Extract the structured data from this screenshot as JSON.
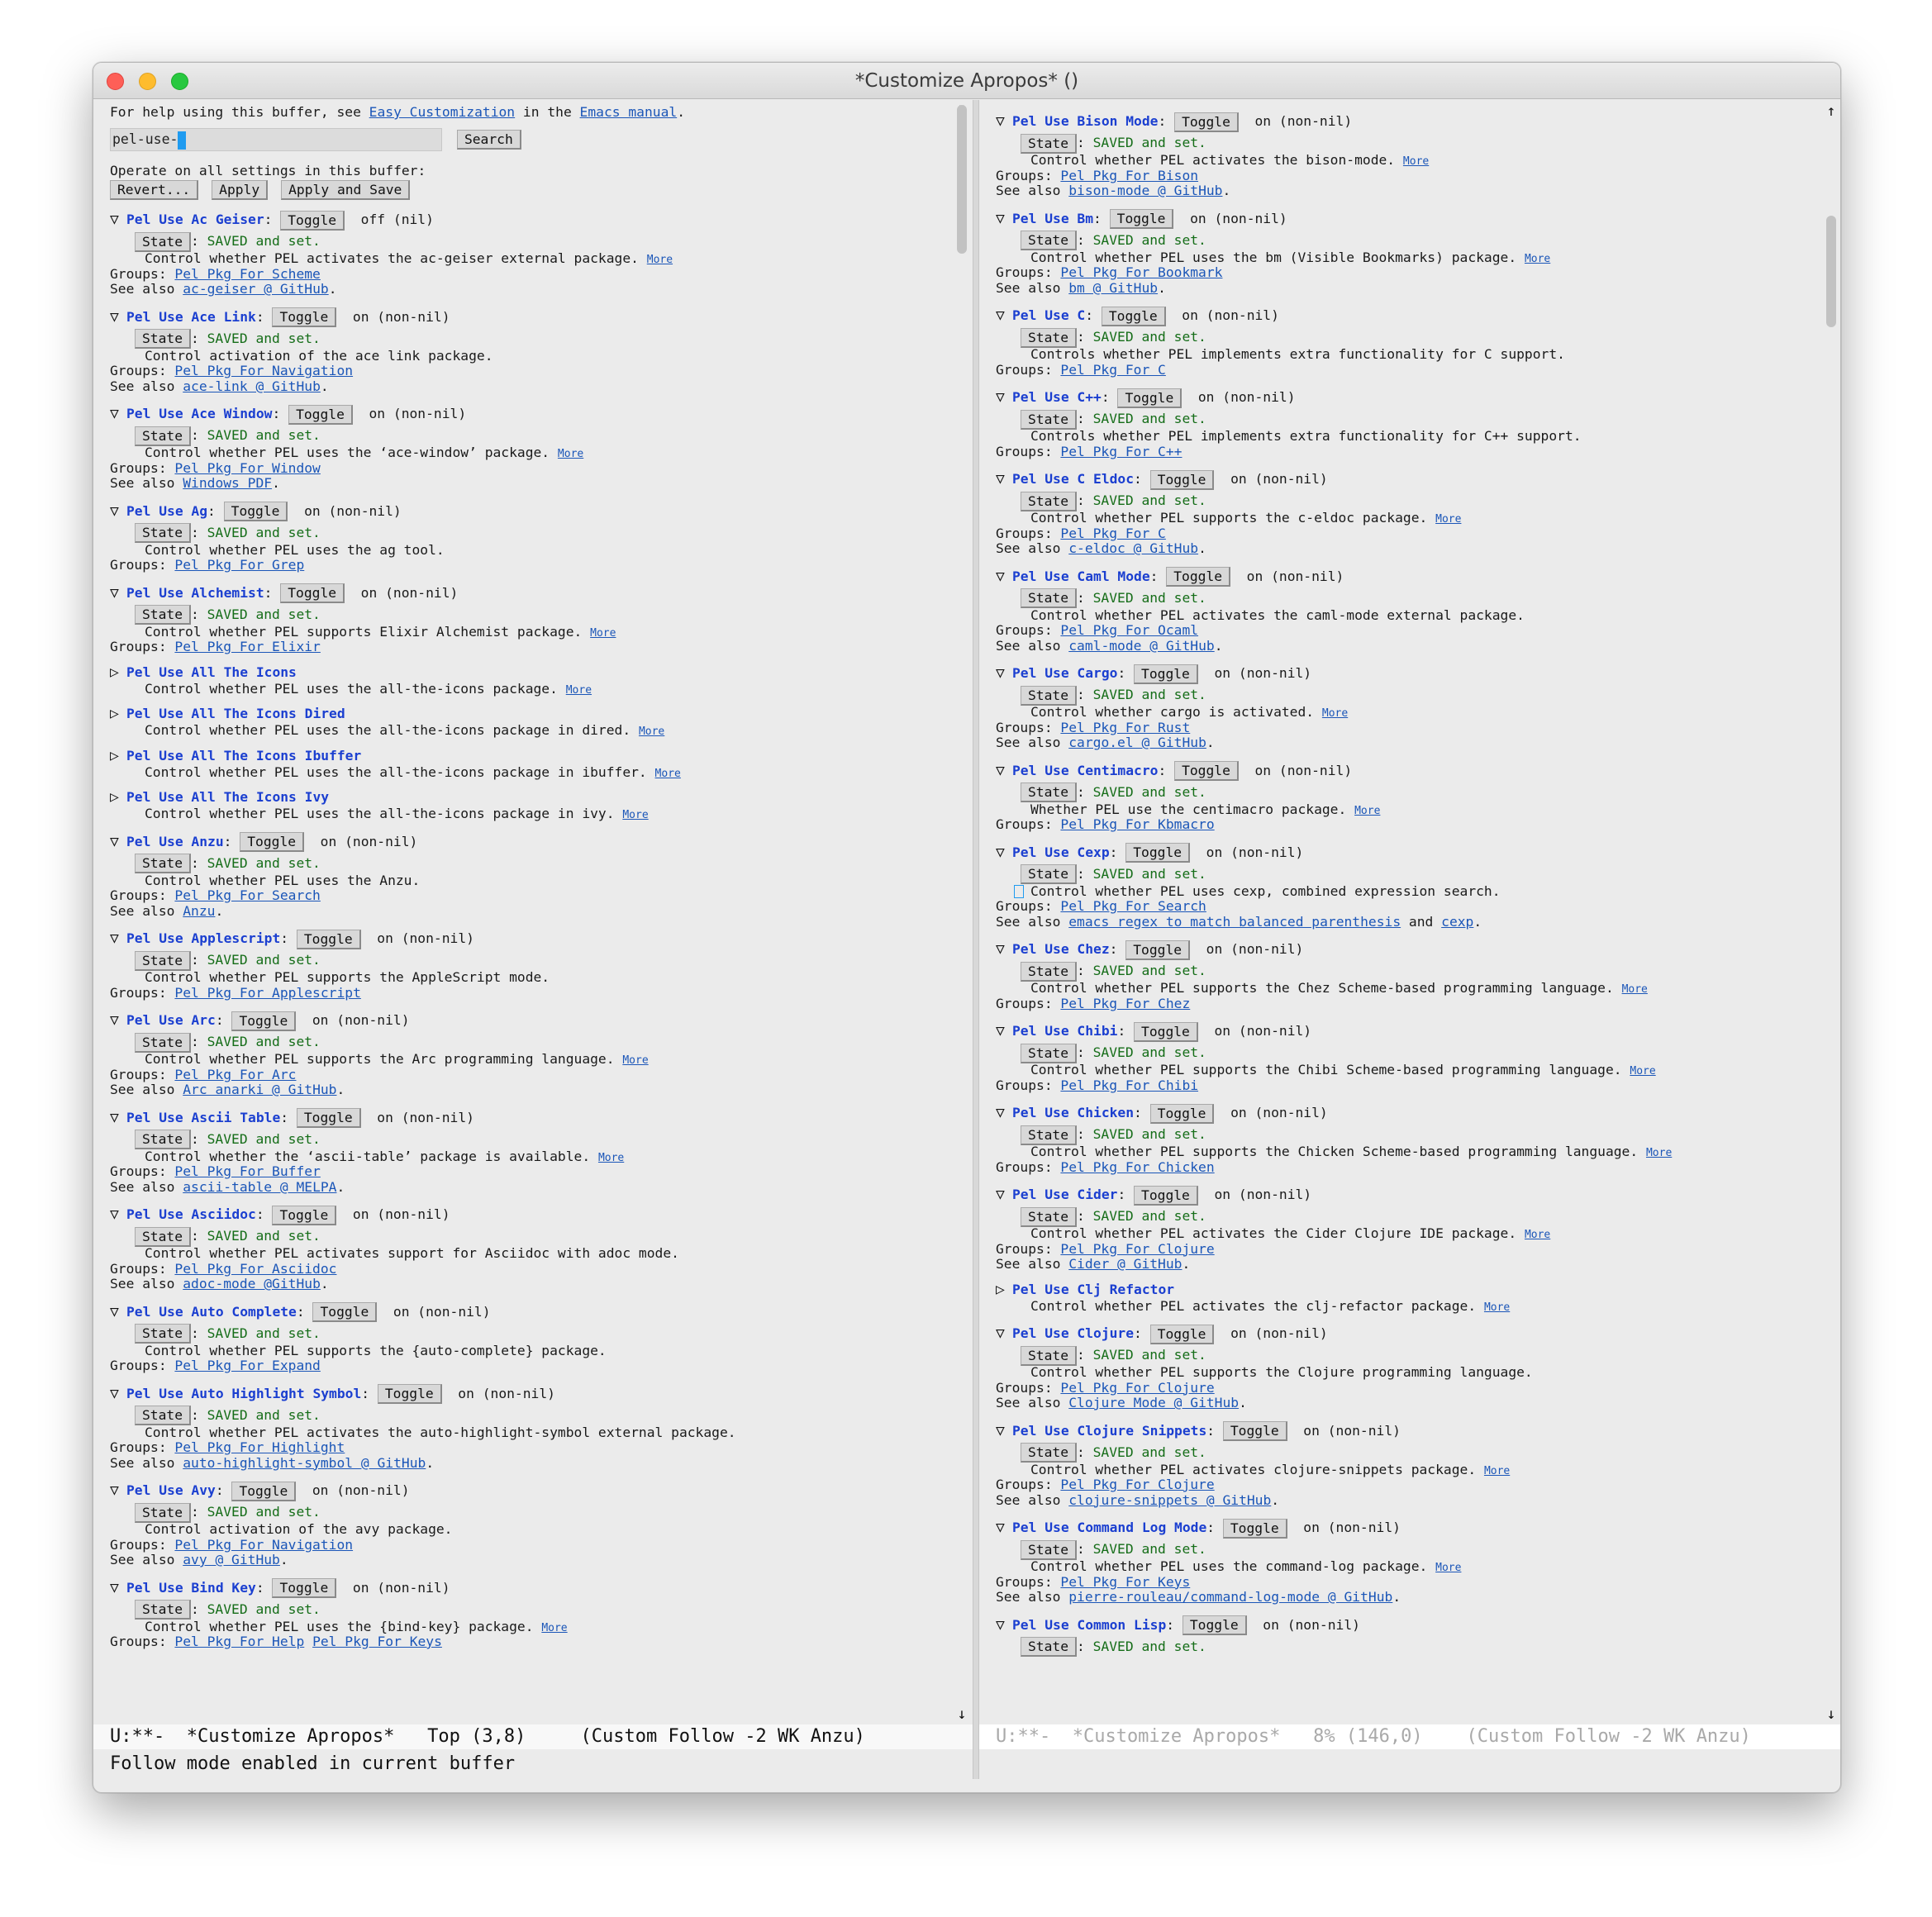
{
  "window": {
    "title": "*Customize Apropos* ()"
  },
  "left": {
    "help": {
      "prefix": "For help using this buffer, see ",
      "link1": "Easy Customization",
      "middle": " in the ",
      "link2": "Emacs manual",
      "suffix": "."
    },
    "search": {
      "value": "pel-use-",
      "button": "Search"
    },
    "operate": {
      "label": "Operate on all settings in this buffer:",
      "revert": "Revert...",
      "apply": "Apply",
      "apply_save": "Apply and Save"
    },
    "items": [
      {
        "expanded": true,
        "name": "Pel Use Ac Geiser",
        "value": "off (nil)",
        "desc": "Control whether PEL activates the ac-geiser external package.",
        "more": true,
        "groups": [
          "Pel Pkg For Scheme"
        ],
        "see": [
          "ac-geiser @ GitHub"
        ]
      },
      {
        "expanded": true,
        "name": "Pel Use Ace Link",
        "value": "on (non-nil)",
        "desc": "Control activation of the ace link package.",
        "more": false,
        "groups": [
          "Pel Pkg For Navigation"
        ],
        "see": [
          "ace-link @ GitHub"
        ]
      },
      {
        "expanded": true,
        "name": "Pel Use Ace Window",
        "value": "on (non-nil)",
        "desc": "Control whether PEL uses the ‘ace-window’ package.",
        "more": true,
        "groups": [
          "Pel Pkg For Window"
        ],
        "see": [
          "Windows PDF"
        ]
      },
      {
        "expanded": true,
        "name": "Pel Use Ag",
        "value": "on (non-nil)",
        "desc": "Control whether PEL uses the ag tool.",
        "more": false,
        "groups": [
          "Pel Pkg For Grep"
        ],
        "see": []
      },
      {
        "expanded": true,
        "name": "Pel Use Alchemist",
        "value": "on (non-nil)",
        "desc": "Control whether PEL supports Elixir Alchemist package.",
        "more": true,
        "groups": [
          "Pel Pkg For Elixir"
        ],
        "see": []
      },
      {
        "expanded": false,
        "name": "Pel Use All The Icons",
        "desc": "Control whether PEL uses the all-the-icons package.",
        "more": true
      },
      {
        "expanded": false,
        "name": "Pel Use All The Icons Dired",
        "desc": "Control whether PEL uses the all-the-icons package in dired.",
        "more": true
      },
      {
        "expanded": false,
        "name": "Pel Use All The Icons Ibuffer",
        "desc": "Control whether PEL uses the all-the-icons package in ibuffer.",
        "more": true
      },
      {
        "expanded": false,
        "name": "Pel Use All The Icons Ivy",
        "desc": "Control whether PEL uses the all-the-icons package in ivy.",
        "more": true
      },
      {
        "expanded": true,
        "name": "Pel Use Anzu",
        "value": "on (non-nil)",
        "desc": "Control whether PEL uses the Anzu.",
        "more": false,
        "groups": [
          "Pel Pkg For Search"
        ],
        "see": [
          "Anzu"
        ]
      },
      {
        "expanded": true,
        "name": "Pel Use Applescript",
        "value": "on (non-nil)",
        "desc": "Control whether PEL supports the AppleScript mode.",
        "more": false,
        "groups": [
          "Pel Pkg For Applescript"
        ],
        "see": []
      },
      {
        "expanded": true,
        "name": "Pel Use Arc",
        "value": "on (non-nil)",
        "desc": "Control whether PEL supports the Arc programming language.",
        "more": true,
        "groups": [
          "Pel Pkg For Arc"
        ],
        "see": [
          "Arc anarki @ GitHub"
        ]
      },
      {
        "expanded": true,
        "name": "Pel Use Ascii Table",
        "value": "on (non-nil)",
        "desc": "Control whether the ‘ascii-table’ package is available.",
        "more": true,
        "groups": [
          "Pel Pkg For Buffer"
        ],
        "see": [
          "ascii-table @ MELPA"
        ]
      },
      {
        "expanded": true,
        "name": "Pel Use Asciidoc",
        "value": "on (non-nil)",
        "desc": "Control whether PEL activates support for Asciidoc with adoc mode.",
        "more": false,
        "groups": [
          "Pel Pkg For Asciidoc"
        ],
        "see": [
          "adoc-mode @GitHub"
        ]
      },
      {
        "expanded": true,
        "name": "Pel Use Auto Complete",
        "value": "on (non-nil)",
        "desc": "Control whether PEL supports the {auto-complete} package.",
        "more": false,
        "groups": [
          "Pel Pkg For Expand"
        ],
        "see": []
      },
      {
        "expanded": true,
        "name": "Pel Use Auto Highlight Symbol",
        "value": "on (non-nil)",
        "desc": "Control whether PEL activates the auto-highlight-symbol external package.",
        "more": false,
        "groups": [
          "Pel Pkg For Highlight"
        ],
        "see": [
          "auto-highlight-symbol @ GitHub"
        ]
      },
      {
        "expanded": true,
        "name": "Pel Use Avy",
        "value": "on (non-nil)",
        "desc": "Control activation of the avy package.",
        "more": false,
        "groups": [
          "Pel Pkg For Navigation"
        ],
        "see": [
          "avy @ GitHub"
        ]
      },
      {
        "expanded": true,
        "name": "Pel Use Bind Key",
        "value": "on (non-nil)",
        "desc": "Control whether PEL uses the {bind-key} package.",
        "more": true,
        "groups": [
          "Pel Pkg For Help",
          "Pel Pkg For Keys"
        ],
        "see": []
      }
    ],
    "modeline": "U:**-  *Customize Apropos*   Top (3,8)     (Custom Follow -2 WK Anzu)"
  },
  "right": {
    "items": [
      {
        "expanded": true,
        "name": "Pel Use Bison Mode",
        "value": "on (non-nil)",
        "desc": "Control whether PEL activates the bison-mode.",
        "more": true,
        "groups": [
          "Pel Pkg For Bison"
        ],
        "see": [
          "bison-mode @ GitHub"
        ]
      },
      {
        "expanded": true,
        "name": "Pel Use Bm",
        "value": "on (non-nil)",
        "desc": "Control whether PEL uses the bm (Visible Bookmarks) package.",
        "more": true,
        "groups": [
          "Pel Pkg For Bookmark"
        ],
        "see": [
          "bm @ GitHub"
        ]
      },
      {
        "expanded": true,
        "name": "Pel Use C",
        "value": "on (non-nil)",
        "desc": "Controls whether PEL implements extra functionality for C support.",
        "more": false,
        "groups": [
          "Pel Pkg For C"
        ],
        "see": []
      },
      {
        "expanded": true,
        "name": "Pel Use C++",
        "value": "on (non-nil)",
        "desc": "Controls whether PEL implements extra functionality for C++ support.",
        "more": false,
        "groups": [
          "Pel Pkg For C++"
        ],
        "see": []
      },
      {
        "expanded": true,
        "name": "Pel Use C Eldoc",
        "value": "on (non-nil)",
        "desc": "Control whether PEL supports the c-eldoc package.",
        "more": true,
        "groups": [
          "Pel Pkg For C"
        ],
        "see": [
          "c-eldoc @ GitHub"
        ]
      },
      {
        "expanded": true,
        "name": "Pel Use Caml Mode",
        "value": "on (non-nil)",
        "desc": "Control whether PEL activates the caml-mode external package.",
        "more": false,
        "groups": [
          "Pel Pkg For Ocaml"
        ],
        "see": [
          "caml-mode @ GitHub"
        ]
      },
      {
        "expanded": true,
        "name": "Pel Use Cargo",
        "value": "on (non-nil)",
        "desc": "Control whether cargo is activated.",
        "more": true,
        "groups": [
          "Pel Pkg For Rust"
        ],
        "see": [
          "cargo.el @ GitHub"
        ]
      },
      {
        "expanded": true,
        "name": "Pel Use Centimacro",
        "value": "on (non-nil)",
        "desc": "Whether PEL use the centimacro package.",
        "more": true,
        "groups": [
          "Pel Pkg For Kbmacro"
        ],
        "see": []
      },
      {
        "expanded": true,
        "name": "Pel Use Cexp",
        "value": "on (non-nil)",
        "desc": "Control whether PEL uses cexp, combined expression search.",
        "more": false,
        "groups": [
          "Pel Pkg For Search"
        ],
        "see": [
          "emacs regex to match balanced parenthesis",
          "cexp"
        ],
        "marker": true
      },
      {
        "expanded": true,
        "name": "Pel Use Chez",
        "value": "on (non-nil)",
        "desc": "Control whether PEL supports the Chez Scheme-based programming language.",
        "more": true,
        "groups": [
          "Pel Pkg For Chez"
        ],
        "see": []
      },
      {
        "expanded": true,
        "name": "Pel Use Chibi",
        "value": "on (non-nil)",
        "desc": "Control whether PEL supports the Chibi Scheme-based programming language.",
        "more": true,
        "groups": [
          "Pel Pkg For Chibi"
        ],
        "see": []
      },
      {
        "expanded": true,
        "name": "Pel Use Chicken",
        "value": "on (non-nil)",
        "desc": "Control whether PEL supports the Chicken Scheme-based programming language.",
        "more": true,
        "groups": [
          "Pel Pkg For Chicken"
        ],
        "see": []
      },
      {
        "expanded": true,
        "name": "Pel Use Cider",
        "value": "on (non-nil)",
        "desc": "Control whether PEL activates the Cider Clojure IDE package.",
        "more": true,
        "groups": [
          "Pel Pkg For Clojure"
        ],
        "see": [
          "Cider @ GitHub"
        ]
      },
      {
        "expanded": false,
        "name": "Pel Use Clj Refactor",
        "desc": "Control whether PEL activates the clj-refactor package.",
        "more": true
      },
      {
        "expanded": true,
        "name": "Pel Use Clojure",
        "value": "on (non-nil)",
        "desc": "Control whether PEL supports the Clojure programming language.",
        "more": false,
        "groups": [
          "Pel Pkg For Clojure"
        ],
        "see": [
          "Clojure Mode @ GitHub"
        ]
      },
      {
        "expanded": true,
        "name": "Pel Use Clojure Snippets",
        "value": "on (non-nil)",
        "desc": "Control whether PEL activates clojure-snippets package.",
        "more": true,
        "groups": [
          "Pel Pkg For Clojure"
        ],
        "see": [
          "clojure-snippets @ GitHub"
        ]
      },
      {
        "expanded": true,
        "name": "Pel Use Command Log Mode",
        "value": "on (non-nil)",
        "desc": "Control whether PEL uses the command-log package.",
        "more": true,
        "groups": [
          "Pel Pkg For Keys"
        ],
        "see": [
          "pierre-rouleau/command-log-mode @ GitHub"
        ]
      },
      {
        "expanded": true,
        "name": "Pel Use Common Lisp",
        "value": "on (non-nil)",
        "desc": "",
        "more": false,
        "groups": [],
        "see": [],
        "partial": true
      }
    ],
    "modeline": "U:**-  *Customize Apropos*   8% (146,0)    (Custom Follow -2 WK Anzu)"
  },
  "labels": {
    "toggle": "Toggle",
    "state": "State",
    "saved": "SAVED and set.",
    "more": "More",
    "groups": "Groups: ",
    "see_also": "See also ",
    "and": " and "
  },
  "echo": "Follow mode enabled in current buffer",
  "colors": {
    "name": "#1b3fd0",
    "link": "#1b56b8",
    "saved": "#156d18",
    "cursor": "#1f9bf0"
  }
}
